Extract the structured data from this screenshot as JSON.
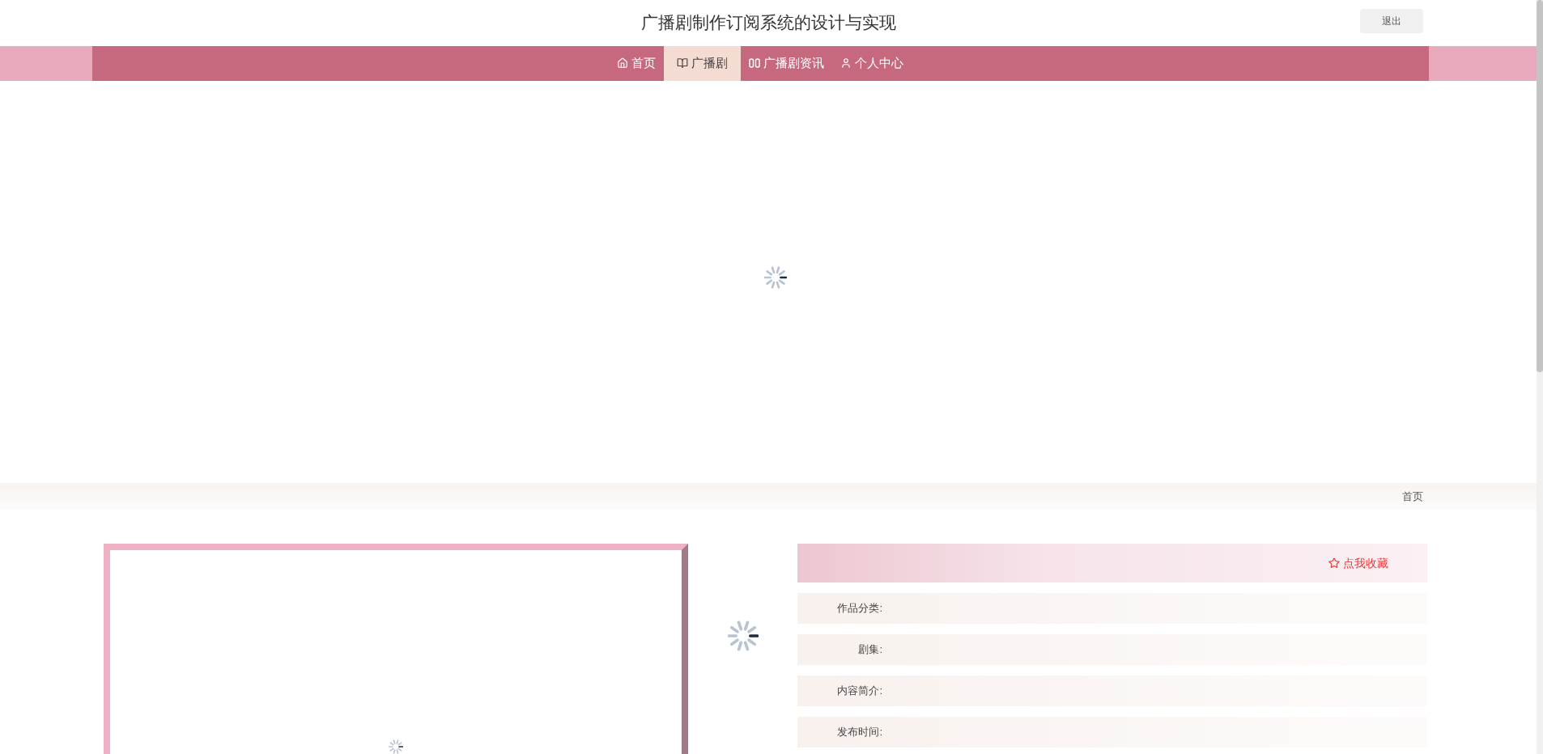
{
  "header": {
    "title": "广播剧制作订阅系统的设计与实现",
    "logout": "退出"
  },
  "nav": [
    {
      "label": "首页",
      "kind": "home",
      "selected": false
    },
    {
      "label": "广播剧",
      "kind": "book",
      "selected": true
    },
    {
      "label": "广播剧资讯",
      "kind": "news",
      "selected": false
    },
    {
      "label": "个人中心",
      "kind": "user",
      "selected": false
    }
  ],
  "breadcrumb": "首页",
  "detail": {
    "favorite": "点我收藏",
    "fields": [
      {
        "label": "作品分类:"
      },
      {
        "label": "剧集:"
      },
      {
        "label": "内容简介:"
      },
      {
        "label": "发布时间:"
      }
    ]
  }
}
